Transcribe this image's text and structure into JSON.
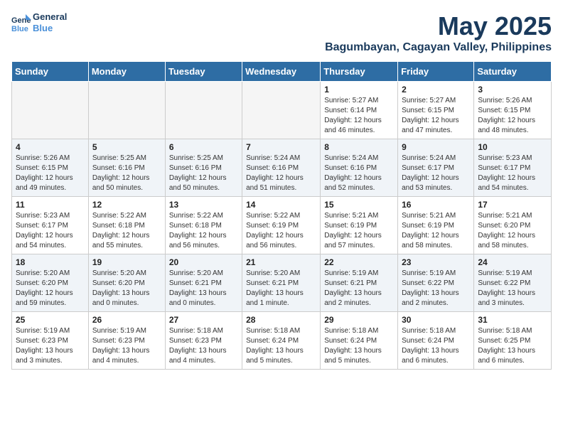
{
  "header": {
    "logo_line1": "General",
    "logo_line2": "Blue",
    "month_year": "May 2025",
    "location": "Bagumbayan, Cagayan Valley, Philippines"
  },
  "weekdays": [
    "Sunday",
    "Monday",
    "Tuesday",
    "Wednesday",
    "Thursday",
    "Friday",
    "Saturday"
  ],
  "weeks": [
    [
      {
        "day": "",
        "info": ""
      },
      {
        "day": "",
        "info": ""
      },
      {
        "day": "",
        "info": ""
      },
      {
        "day": "",
        "info": ""
      },
      {
        "day": "1",
        "info": "Sunrise: 5:27 AM\nSunset: 6:14 PM\nDaylight: 12 hours\nand 46 minutes."
      },
      {
        "day": "2",
        "info": "Sunrise: 5:27 AM\nSunset: 6:15 PM\nDaylight: 12 hours\nand 47 minutes."
      },
      {
        "day": "3",
        "info": "Sunrise: 5:26 AM\nSunset: 6:15 PM\nDaylight: 12 hours\nand 48 minutes."
      }
    ],
    [
      {
        "day": "4",
        "info": "Sunrise: 5:26 AM\nSunset: 6:15 PM\nDaylight: 12 hours\nand 49 minutes."
      },
      {
        "day": "5",
        "info": "Sunrise: 5:25 AM\nSunset: 6:16 PM\nDaylight: 12 hours\nand 50 minutes."
      },
      {
        "day": "6",
        "info": "Sunrise: 5:25 AM\nSunset: 6:16 PM\nDaylight: 12 hours\nand 50 minutes."
      },
      {
        "day": "7",
        "info": "Sunrise: 5:24 AM\nSunset: 6:16 PM\nDaylight: 12 hours\nand 51 minutes."
      },
      {
        "day": "8",
        "info": "Sunrise: 5:24 AM\nSunset: 6:16 PM\nDaylight: 12 hours\nand 52 minutes."
      },
      {
        "day": "9",
        "info": "Sunrise: 5:24 AM\nSunset: 6:17 PM\nDaylight: 12 hours\nand 53 minutes."
      },
      {
        "day": "10",
        "info": "Sunrise: 5:23 AM\nSunset: 6:17 PM\nDaylight: 12 hours\nand 54 minutes."
      }
    ],
    [
      {
        "day": "11",
        "info": "Sunrise: 5:23 AM\nSunset: 6:17 PM\nDaylight: 12 hours\nand 54 minutes."
      },
      {
        "day": "12",
        "info": "Sunrise: 5:22 AM\nSunset: 6:18 PM\nDaylight: 12 hours\nand 55 minutes."
      },
      {
        "day": "13",
        "info": "Sunrise: 5:22 AM\nSunset: 6:18 PM\nDaylight: 12 hours\nand 56 minutes."
      },
      {
        "day": "14",
        "info": "Sunrise: 5:22 AM\nSunset: 6:19 PM\nDaylight: 12 hours\nand 56 minutes."
      },
      {
        "day": "15",
        "info": "Sunrise: 5:21 AM\nSunset: 6:19 PM\nDaylight: 12 hours\nand 57 minutes."
      },
      {
        "day": "16",
        "info": "Sunrise: 5:21 AM\nSunset: 6:19 PM\nDaylight: 12 hours\nand 58 minutes."
      },
      {
        "day": "17",
        "info": "Sunrise: 5:21 AM\nSunset: 6:20 PM\nDaylight: 12 hours\nand 58 minutes."
      }
    ],
    [
      {
        "day": "18",
        "info": "Sunrise: 5:20 AM\nSunset: 6:20 PM\nDaylight: 12 hours\nand 59 minutes."
      },
      {
        "day": "19",
        "info": "Sunrise: 5:20 AM\nSunset: 6:20 PM\nDaylight: 13 hours\nand 0 minutes."
      },
      {
        "day": "20",
        "info": "Sunrise: 5:20 AM\nSunset: 6:21 PM\nDaylight: 13 hours\nand 0 minutes."
      },
      {
        "day": "21",
        "info": "Sunrise: 5:20 AM\nSunset: 6:21 PM\nDaylight: 13 hours\nand 1 minute."
      },
      {
        "day": "22",
        "info": "Sunrise: 5:19 AM\nSunset: 6:21 PM\nDaylight: 13 hours\nand 2 minutes."
      },
      {
        "day": "23",
        "info": "Sunrise: 5:19 AM\nSunset: 6:22 PM\nDaylight: 13 hours\nand 2 minutes."
      },
      {
        "day": "24",
        "info": "Sunrise: 5:19 AM\nSunset: 6:22 PM\nDaylight: 13 hours\nand 3 minutes."
      }
    ],
    [
      {
        "day": "25",
        "info": "Sunrise: 5:19 AM\nSunset: 6:23 PM\nDaylight: 13 hours\nand 3 minutes."
      },
      {
        "day": "26",
        "info": "Sunrise: 5:19 AM\nSunset: 6:23 PM\nDaylight: 13 hours\nand 4 minutes."
      },
      {
        "day": "27",
        "info": "Sunrise: 5:18 AM\nSunset: 6:23 PM\nDaylight: 13 hours\nand 4 minutes."
      },
      {
        "day": "28",
        "info": "Sunrise: 5:18 AM\nSunset: 6:24 PM\nDaylight: 13 hours\nand 5 minutes."
      },
      {
        "day": "29",
        "info": "Sunrise: 5:18 AM\nSunset: 6:24 PM\nDaylight: 13 hours\nand 5 minutes."
      },
      {
        "day": "30",
        "info": "Sunrise: 5:18 AM\nSunset: 6:24 PM\nDaylight: 13 hours\nand 6 minutes."
      },
      {
        "day": "31",
        "info": "Sunrise: 5:18 AM\nSunset: 6:25 PM\nDaylight: 13 hours\nand 6 minutes."
      }
    ]
  ]
}
